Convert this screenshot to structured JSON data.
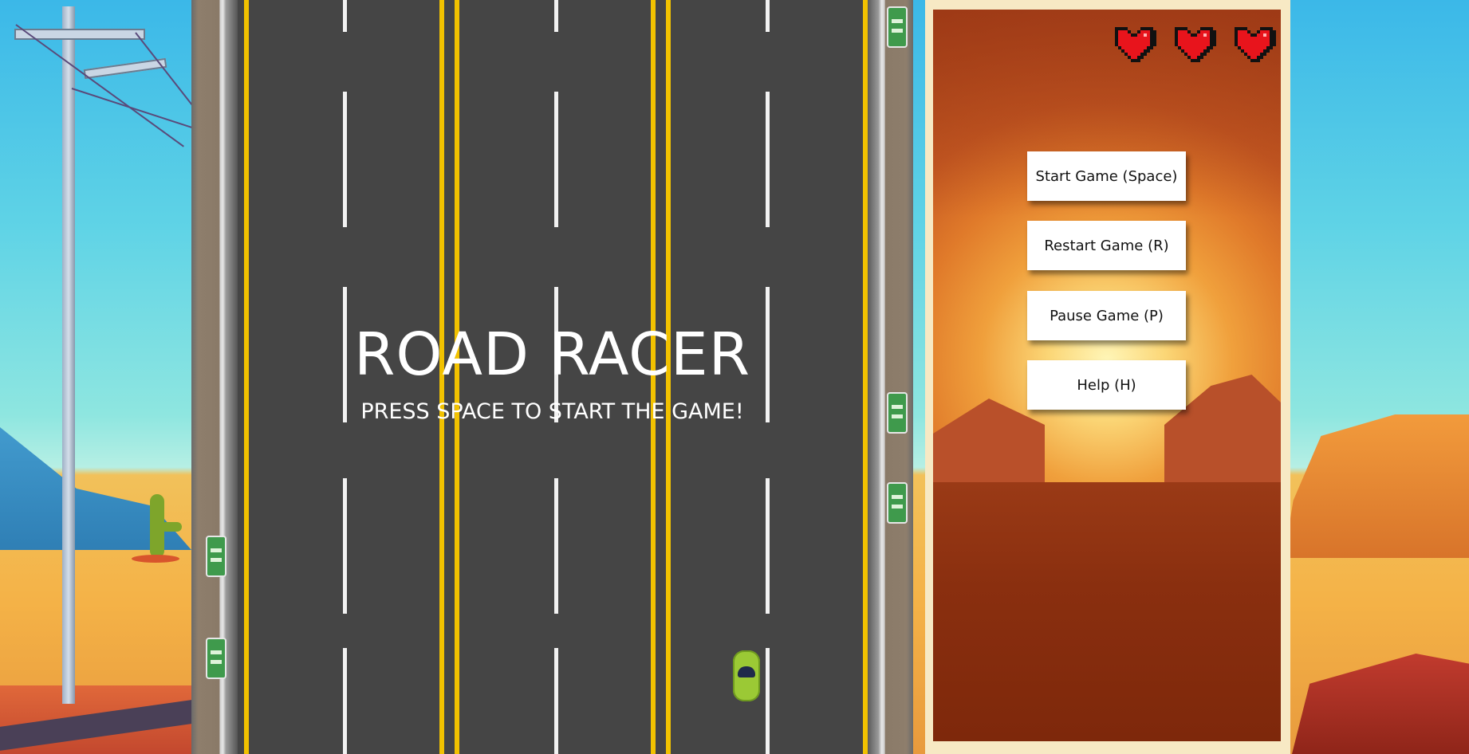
{
  "game": {
    "title": "ROAD RACER",
    "subtitle": "PRESS SPACE TO START THE GAME!"
  },
  "menu": {
    "buttons": [
      {
        "label": "Start Game (Space)"
      },
      {
        "label": "Restart Game (R)"
      },
      {
        "label": "Pause Game (P)"
      },
      {
        "label": "Help (H)"
      }
    ]
  },
  "lives": {
    "count": 3,
    "icon": "heart-icon",
    "color": "#e8141c"
  },
  "colors": {
    "asphalt": "#454545",
    "yellow_line": "#f2c200",
    "player_car": "#9bc935"
  }
}
